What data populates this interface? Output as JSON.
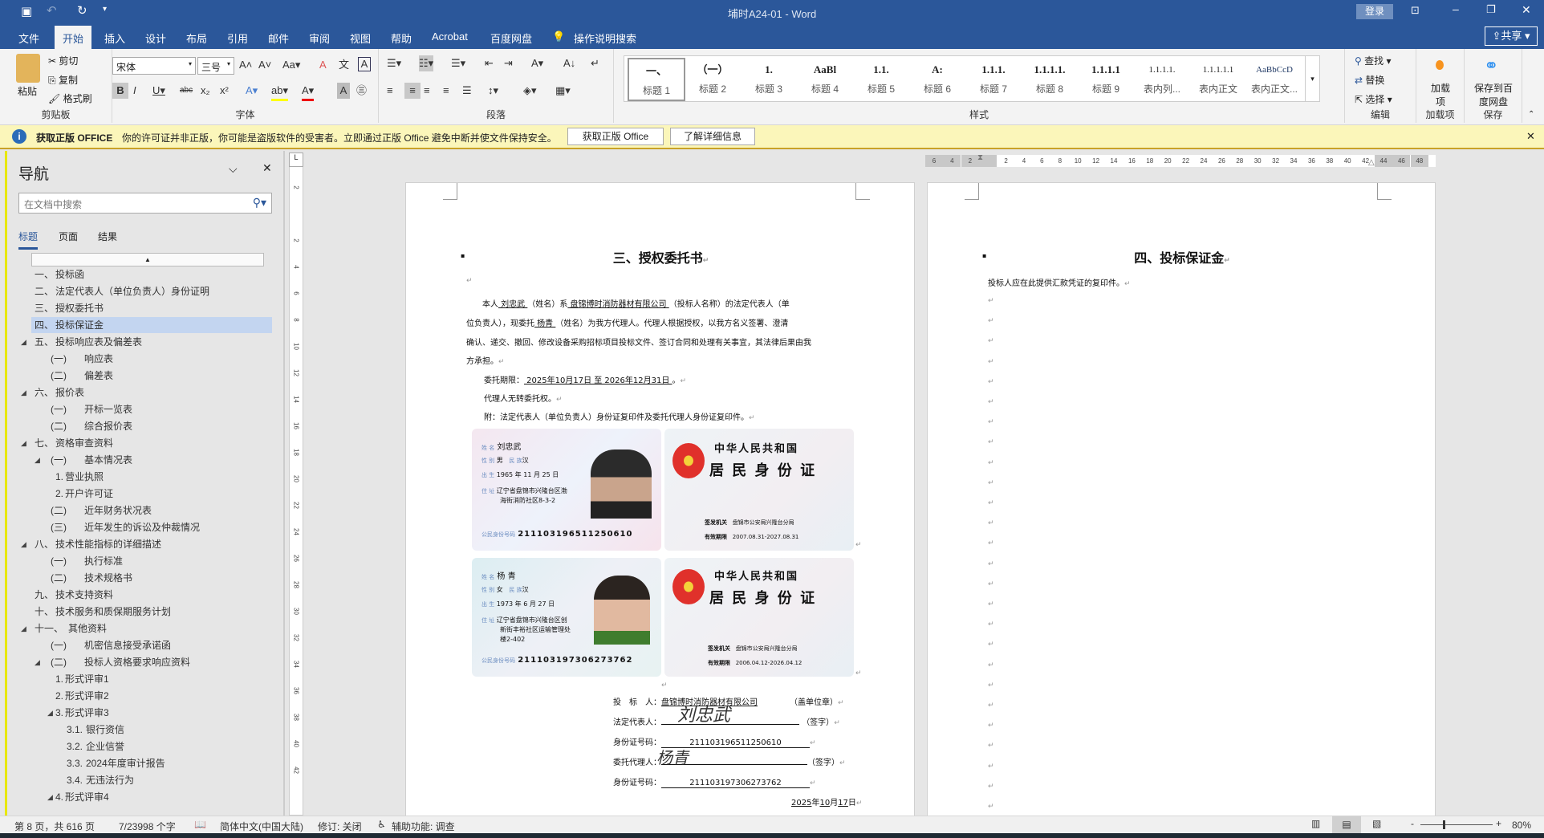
{
  "title": {
    "doc": "埔时A24-01",
    "sep": "-",
    "app": "Word",
    "login": "登录"
  },
  "tabs": [
    "文件",
    "开始",
    "插入",
    "设计",
    "布局",
    "引用",
    "邮件",
    "审阅",
    "视图",
    "帮助",
    "Acrobat",
    "百度网盘"
  ],
  "tell_me": "操作说明搜索",
  "share": "共享",
  "clipboard": {
    "paste": "粘贴",
    "cut": "剪切",
    "copy": "复制",
    "format_painter": "格式刷",
    "label": "剪贴板"
  },
  "font": {
    "name": "宋体",
    "size": "三号",
    "label": "字体"
  },
  "paragraph": {
    "label": "段落"
  },
  "styles": {
    "label": "样式",
    "items": [
      {
        "preview": "一、",
        "name": "标题 1"
      },
      {
        "preview": "（一）",
        "name": "标题 2"
      },
      {
        "preview": "1.",
        "name": "标题 3"
      },
      {
        "preview": "AaBl",
        "name": "标题 4"
      },
      {
        "preview": "1.1.",
        "name": "标题 5"
      },
      {
        "preview": "A:",
        "name": "标题 6"
      },
      {
        "preview": "1.1.1.",
        "name": "标题 7"
      },
      {
        "preview": "1.1.1.1.",
        "name": "标题 8"
      },
      {
        "preview": "1.1.1.1",
        "name": "标题 9"
      },
      {
        "preview": "1.1.1.1.",
        "name": "表内列..."
      },
      {
        "preview": "1.1.1.1.1",
        "name": "表内正文"
      },
      {
        "preview": "AaBbCcD",
        "name": "表内正文..."
      }
    ]
  },
  "editing": {
    "find": "查找",
    "replace": "替换",
    "select": "选择",
    "label": "编辑"
  },
  "addins": {
    "btn": "加载项",
    "label": "加载项"
  },
  "baidu": {
    "btn": "保存到百度网盘",
    "label": "保存"
  },
  "infobar": {
    "title": "获取正版 OFFICE",
    "message": "你的许可证并非正版，你可能是盗版软件的受害者。立即通过正版 Office 避免中断并使文件保持安全。",
    "btn_get": "获取正版 Office",
    "btn_learn": "了解详细信息"
  },
  "nav": {
    "title": "导航",
    "search_placeholder": "在文档中搜索",
    "tabs": [
      "标题",
      "页面",
      "结果"
    ],
    "items": [
      {
        "num": "一、",
        "text": "投标函",
        "level": 0
      },
      {
        "num": "二、",
        "text": "法定代表人（单位负责人）身份证明",
        "level": 0
      },
      {
        "num": "三、",
        "text": "授权委托书",
        "level": 0
      },
      {
        "num": "四、",
        "text": "投标保证金",
        "level": 0,
        "selected": true
      },
      {
        "num": "五、",
        "text": "投标响应表及偏差表",
        "level": 0,
        "expanded": true
      },
      {
        "num": "(一)",
        "text": "响应表",
        "level": 1
      },
      {
        "num": "(二)",
        "text": "偏差表",
        "level": 1
      },
      {
        "num": "六、",
        "text": "报价表",
        "level": 0,
        "expanded": true
      },
      {
        "num": "(一)",
        "text": "开标一览表",
        "level": 1
      },
      {
        "num": "(二)",
        "text": "综合报价表",
        "level": 1
      },
      {
        "num": "七、",
        "text": "资格审查资料",
        "level": 0,
        "expanded": true
      },
      {
        "num": "(一)",
        "text": "基本情况表",
        "level": 1,
        "expanded": true
      },
      {
        "num": "1.",
        "text": "营业执照",
        "level": 2
      },
      {
        "num": "2.",
        "text": "开户许可证",
        "level": 2
      },
      {
        "num": "(二)",
        "text": "近年财务状况表",
        "level": 1
      },
      {
        "num": "(三)",
        "text": "近年发生的诉讼及仲裁情况",
        "level": 1
      },
      {
        "num": "八、",
        "text": "技术性能指标的详细描述",
        "level": 0,
        "expanded": true
      },
      {
        "num": "(一)",
        "text": "执行标准",
        "level": 1
      },
      {
        "num": "(二)",
        "text": "技术规格书",
        "level": 1
      },
      {
        "num": "九、",
        "text": "技术支持资料",
        "level": 0
      },
      {
        "num": "十、",
        "text": "技术服务和质保期服务计划",
        "level": 0
      },
      {
        "num": "十一、",
        "text": "其他资料",
        "level": 0,
        "expanded": true
      },
      {
        "num": "(一)",
        "text": "机密信息接受承诺函",
        "level": 1
      },
      {
        "num": "(二)",
        "text": "投标人资格要求响应资料",
        "level": 1,
        "expanded": true
      },
      {
        "num": "1.",
        "text": "形式评审1",
        "level": 2
      },
      {
        "num": "2.",
        "text": "形式评审2",
        "level": 2
      },
      {
        "num": "3.",
        "text": "形式评审3",
        "level": 2,
        "expanded": true
      },
      {
        "num": "3.1.",
        "text": "银行资信",
        "level": 3
      },
      {
        "num": "3.2.",
        "text": "企业信誉",
        "level": 3
      },
      {
        "num": "3.3.",
        "text": "2024年度审计报告",
        "level": 3
      },
      {
        "num": "3.4.",
        "text": "无违法行为",
        "level": 3
      },
      {
        "num": "4.",
        "text": "形式评审4",
        "level": 2,
        "expanded": true
      }
    ]
  },
  "ruler": {
    "h": [
      "6",
      "4",
      "2",
      "",
      "2",
      "4",
      "6",
      "8",
      "10",
      "12",
      "14",
      "16",
      "18",
      "20",
      "22",
      "24",
      "26",
      "28",
      "30",
      "32",
      "34",
      "36",
      "38",
      "40",
      "42",
      "44",
      "46",
      "48"
    ],
    "v": [
      "4",
      "2",
      "",
      "2",
      "4",
      "6",
      "8",
      "10",
      "12",
      "14",
      "16",
      "18",
      "20",
      "22",
      "24",
      "26",
      "28",
      "30",
      "32",
      "34",
      "36",
      "38",
      "40",
      "42"
    ]
  },
  "page1": {
    "heading": "三、授权委托书",
    "p1": {
      "a": "本人",
      "name": "  刘忠武  ",
      "b": "（姓名）系",
      "company": "  盘锦博时消防器材有限公司  ",
      "c": "（投标人名称）的法定代表人（单"
    },
    "p2": {
      "a": "位负责人），现委托",
      "agent": "    杨青    ",
      "b": "（姓名）为我方代理人。代理人根据授权，以我方名义签署、澄清"
    },
    "p3": "确认、递交、撤回、修改设备采购招标项目投标文件、签订合同和处理有关事宜，其法律后果由我",
    "p4": "方承担。",
    "term_label": "委托期限：",
    "term_value": " 2025年10月17日 至 2026年12月31日 ",
    "term_end": "。",
    "no_sub": "代理人无转委托权。",
    "attach": "附：法定代表人（单位负责人）身份证复印件及委托代理人身份证复印件。",
    "id1": {
      "name_l": "姓 名",
      "name": "刘忠武",
      "sex_l": "性 别",
      "sex": "男",
      "eth_l": "民 族",
      "eth": "汉",
      "birth_l": "出 生",
      "birth": "1965 年 11 月 25 日",
      "addr_l": "住 址",
      "addr1": "辽宁省盘锦市兴隆台区渤",
      "addr2": "海街消防社区8-3-2",
      "num_l": "公民身份号码",
      "num": "211103196511250610",
      "country": "中华人民共和国",
      "card": "居 民 身 份 证",
      "issuer_l": "签发机关",
      "issuer": "盘锦市公安局兴隆台分局",
      "valid_l": "有效期限",
      "valid": "2007.08.31-2027.08.31"
    },
    "id2": {
      "name_l": "姓 名",
      "name": "杨 青",
      "sex_l": "性 别",
      "sex": "女",
      "eth_l": "民 族",
      "eth": "汉",
      "birth_l": "出 生",
      "birth": "1973 年 6 月 27 日",
      "addr_l": "住 址",
      "addr1": "辽宁省盘锦市兴隆台区创",
      "addr2": "新街丰裕社区运输管理处",
      "addr3": "楼2-402",
      "num_l": "公民身份号码",
      "num": "211103197306273762",
      "country": "中华人民共和国",
      "card": "居 民 身 份 证",
      "issuer_l": "签发机关",
      "issuer": "盘锦市公安局兴隆台分局",
      "valid_l": "有效期限",
      "valid": "2006.04.12-2026.04.12"
    },
    "sig": {
      "bidder_l": "投　标　人：",
      "bidder": "盘锦博时消防器材有限公司",
      "bidder_s": "（盖单位章）",
      "legal_l": "法定代表人：",
      "legal_s": "（签字）",
      "id_l": "身份证号码：",
      "legal_id": "211103196511250610",
      "agent_l": "委托代理人：",
      "agent_s": "（签字）",
      "agent_id": "211103197306273762",
      "date_y": "2025",
      "date_yl": "年",
      "date_m": "10",
      "date_ml": "月",
      "date_d": "17",
      "date_dl": "日"
    }
  },
  "page2": {
    "heading": "四、投标保证金",
    "text": "投标人应在此提供汇款凭证的复印件。",
    "marks": 26
  },
  "status": {
    "page": "第 8 页，共 616 页",
    "words": "7/23998 个字",
    "lang": "简体中文(中国大陆)",
    "track": "修订: 关闭",
    "access": "辅助功能: 调查",
    "zoom": "80%"
  },
  "colors": {
    "brand": "#2b579a",
    "info": "#fbf6ba",
    "selected": "#c3d5f0"
  }
}
